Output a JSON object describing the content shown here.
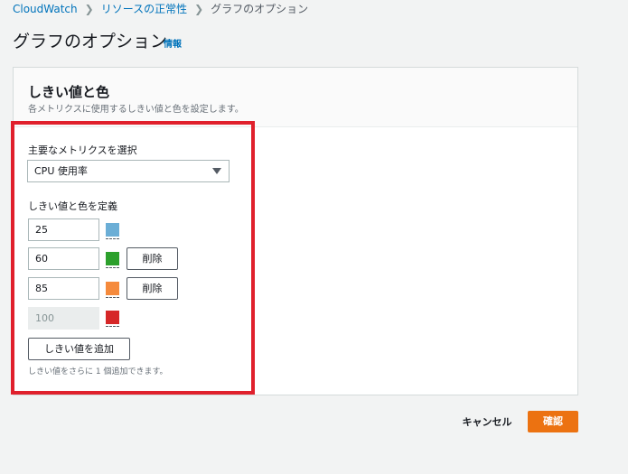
{
  "breadcrumb": {
    "items": [
      "CloudWatch",
      "リソースの正常性",
      "グラフのオプション"
    ]
  },
  "page": {
    "title": "グラフのオプション",
    "info_link": "情報"
  },
  "panel": {
    "title": "しきい値と色",
    "description": "各メトリクスに使用するしきい値と色を設定します。"
  },
  "metric": {
    "label": "主要なメトリクスを選択",
    "selected": "CPU 使用率"
  },
  "thresholds": {
    "label": "しきい値と色を定義",
    "rows": [
      {
        "value": "25",
        "color": "#6baed6",
        "removable": false,
        "disabled": false
      },
      {
        "value": "60",
        "color": "#2ca02c",
        "removable": true,
        "disabled": false
      },
      {
        "value": "85",
        "color": "#f58a3c",
        "removable": true,
        "disabled": false
      },
      {
        "value": "100",
        "color": "#d62728",
        "removable": false,
        "disabled": true
      }
    ],
    "delete_label": "削除",
    "add_label": "しきい値を追加",
    "hint": "しきい値をさらに 1 個追加できます。"
  },
  "footer": {
    "cancel_label": "キャンセル",
    "confirm_label": "確認"
  },
  "colors": {
    "accent": "#ec7211",
    "link": "#0073bb",
    "highlight": "#e0202c"
  }
}
